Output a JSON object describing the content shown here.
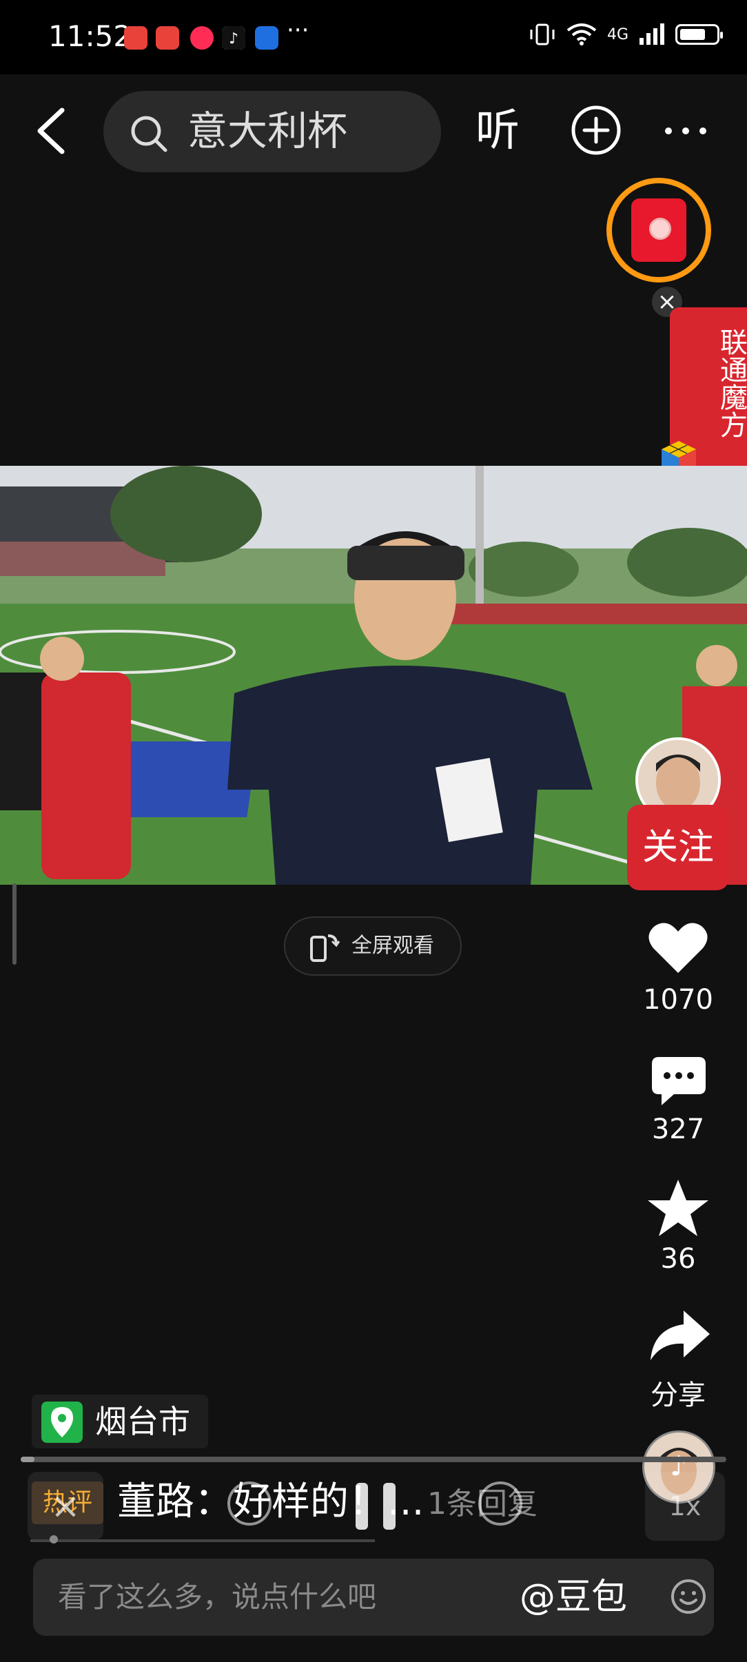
{
  "status_bar": {
    "time": "11:52",
    "more": "···",
    "network": "4G",
    "battery_level": 0.7,
    "app_icon_colors": [
      "#e8423a",
      "#e8423a",
      "#ff2d55",
      "#111111",
      "#1f6fe0"
    ]
  },
  "top_bar": {
    "search_text": "意大利杯",
    "listen_label": "听"
  },
  "promo": {
    "banner_text": "联通魔方",
    "close": "×"
  },
  "fullscreen": {
    "label": "全屏观看"
  },
  "actions": {
    "follow_label": "关注",
    "likes": "1070",
    "comments": "327",
    "favorites": "36",
    "share_label": "分享"
  },
  "location": {
    "label": "烟台市"
  },
  "playback": {
    "progress": 0.02,
    "speed": "1x",
    "close": "×"
  },
  "hot_comment": {
    "badge": "热评",
    "text": "董路：好样的！...",
    "replies": "1条回复"
  },
  "comment_box": {
    "placeholder": "看了这么多，说点什么吧",
    "mention_button": "@豆包"
  },
  "colors": {
    "accent_red": "#d8262f",
    "ring_orange": "#ff9a12",
    "hot_badge_text": "#f5a623",
    "location_green": "#21b34a"
  }
}
